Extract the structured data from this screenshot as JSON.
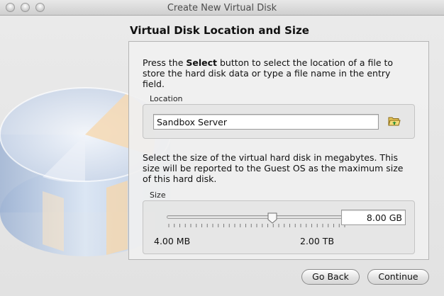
{
  "window": {
    "title": "Create New Virtual Disk"
  },
  "page": {
    "heading": "Virtual Disk Location and Size",
    "intro_pre": "Press the ",
    "intro_bold": "Select",
    "intro_post": " button to select the location of a file to store the hard disk data or type a file name in the entry field."
  },
  "location": {
    "label": "Location",
    "value": "Sandbox Server",
    "select_icon": "folder-open-icon"
  },
  "size": {
    "description": "Select the size of the virtual hard disk in megabytes. This size will be reported to the Guest OS as the maximum size of this hard disk.",
    "label": "Size",
    "value": "8.00 GB",
    "min_label": "4.00 MB",
    "max_label": "2.00 TB",
    "slider_position_fraction": 0.59,
    "tick_count": 33
  },
  "buttons": {
    "back": "Go Back",
    "continue": "Continue"
  },
  "colors": {
    "accent": "#4a7fd0"
  }
}
